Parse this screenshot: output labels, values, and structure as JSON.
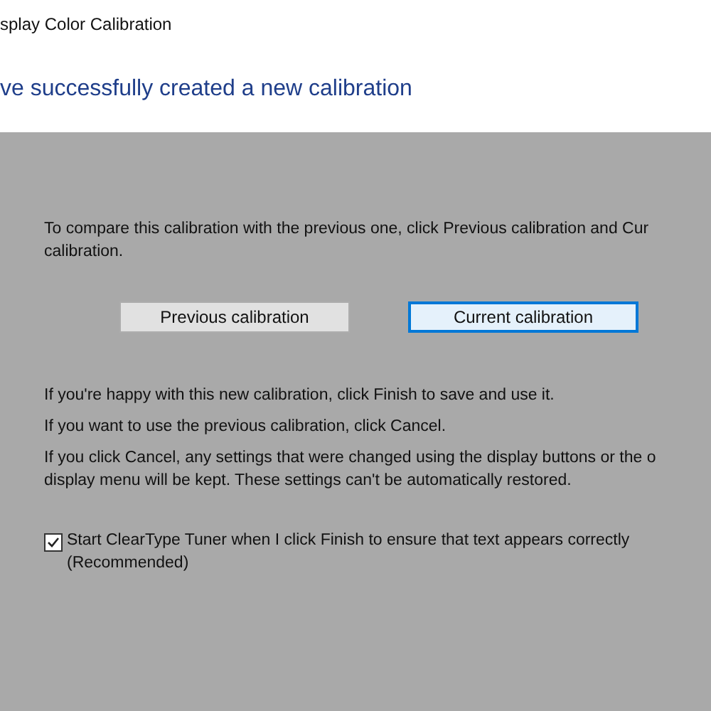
{
  "window": {
    "title": "splay Color Calibration"
  },
  "heading": "ve successfully created a new calibration",
  "intro": "To compare this calibration with the previous one, click Previous calibration and Cur\ncalibration.",
  "buttons": [
    {
      "label": "Previous calibration",
      "focused": false
    },
    {
      "label": "Current calibration",
      "focused": true
    }
  ],
  "paragraphs": [
    "If you're happy with this new calibration, click Finish to save and use it.",
    "If you want to use the previous calibration, click Cancel.",
    "If you click Cancel, any settings that were changed using the display buttons or the o\ndisplay menu will be kept. These settings can't be automatically restored."
  ],
  "cleartype": {
    "label": "Start ClearType Tuner when I click Finish to ensure that text appears correctly\n(Recommended)",
    "checked": true
  }
}
